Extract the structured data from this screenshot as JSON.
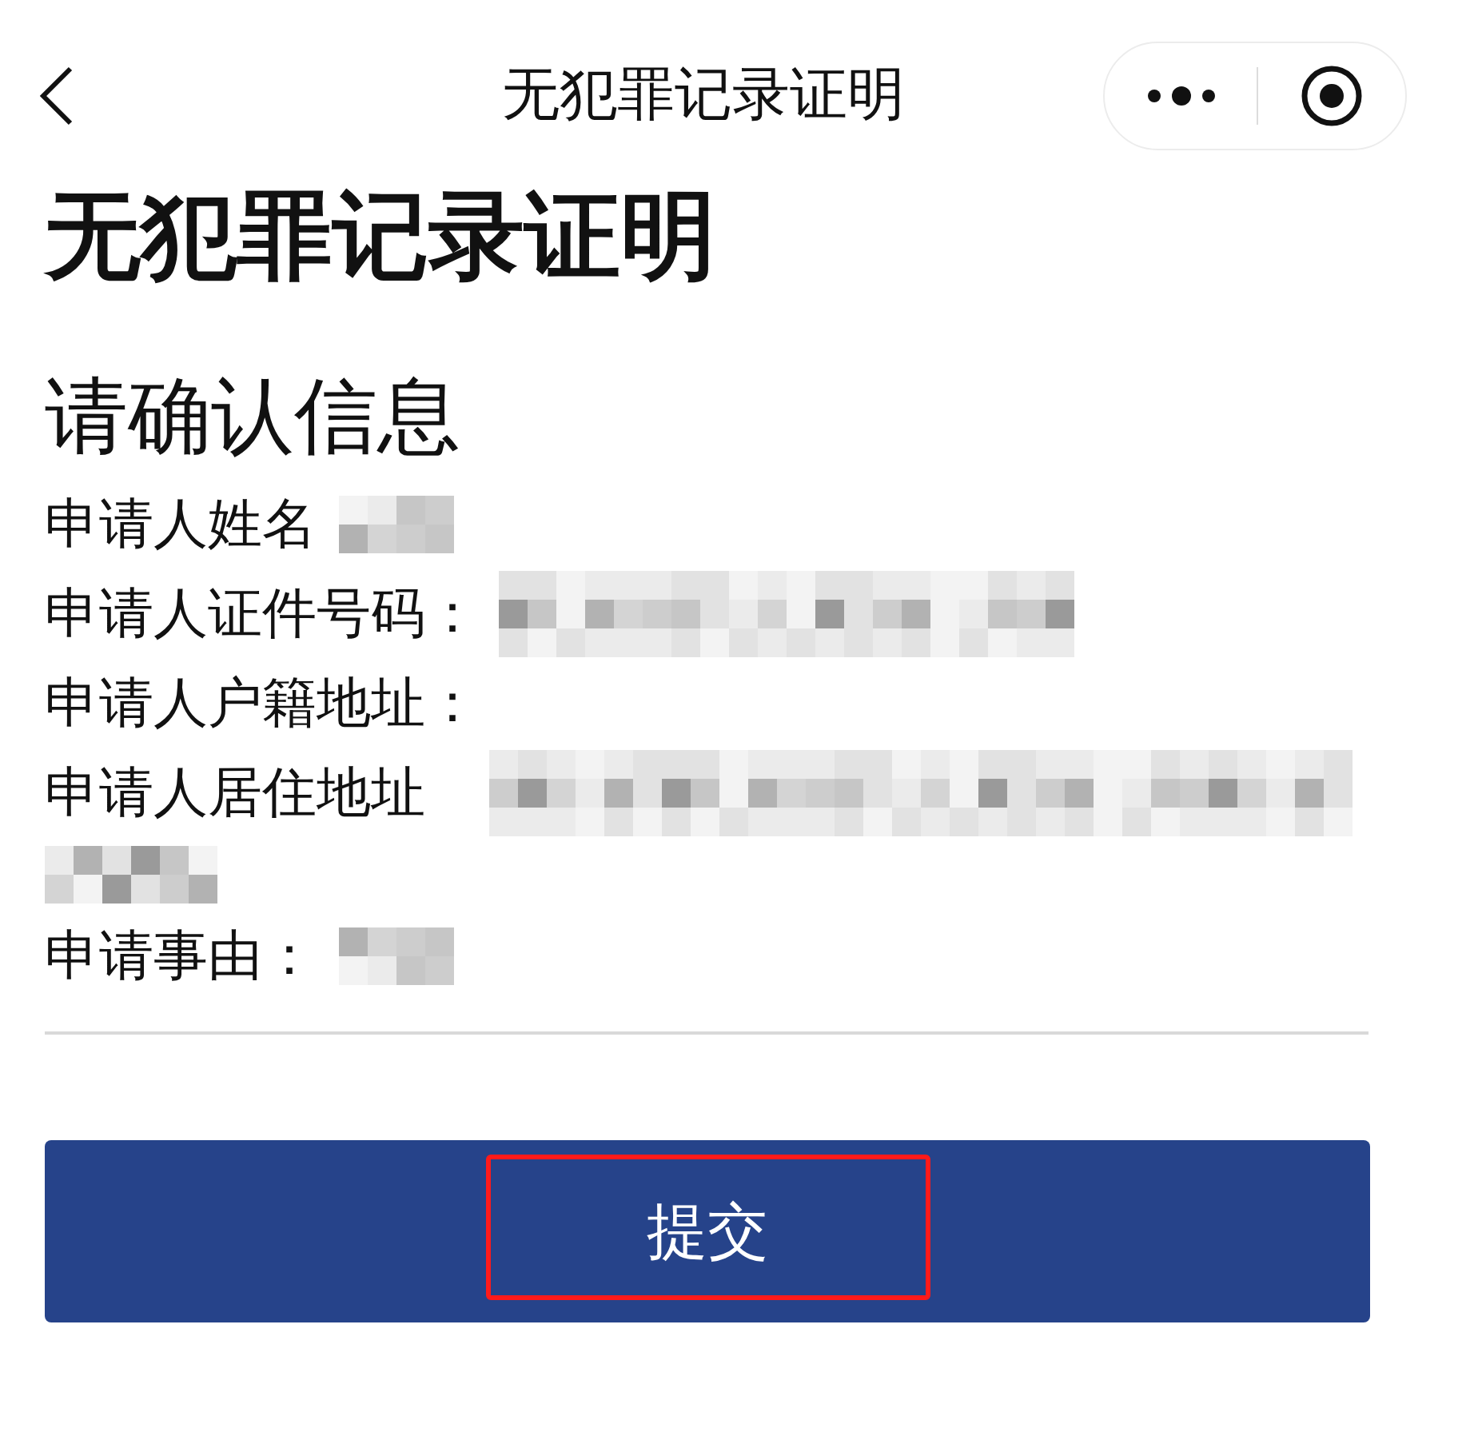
{
  "nav_bar": {
    "title": "无犯罪记录证明"
  },
  "page_title": "无犯罪记录证明",
  "section_title": "请确认信息",
  "fields": [
    {
      "label": "申请人姓名",
      "kind": "redacted_short"
    },
    {
      "label": "申请人证件号码：",
      "kind": "redacted_long"
    },
    {
      "label": "申请人户籍地址：",
      "kind": "empty"
    },
    {
      "label": "申请人居住地址",
      "kind": "redacted_wrapped"
    },
    {
      "label": "申请事由：",
      "kind": "redacted_short"
    }
  ],
  "submit_button": {
    "label": "提交",
    "highlighted": true
  }
}
